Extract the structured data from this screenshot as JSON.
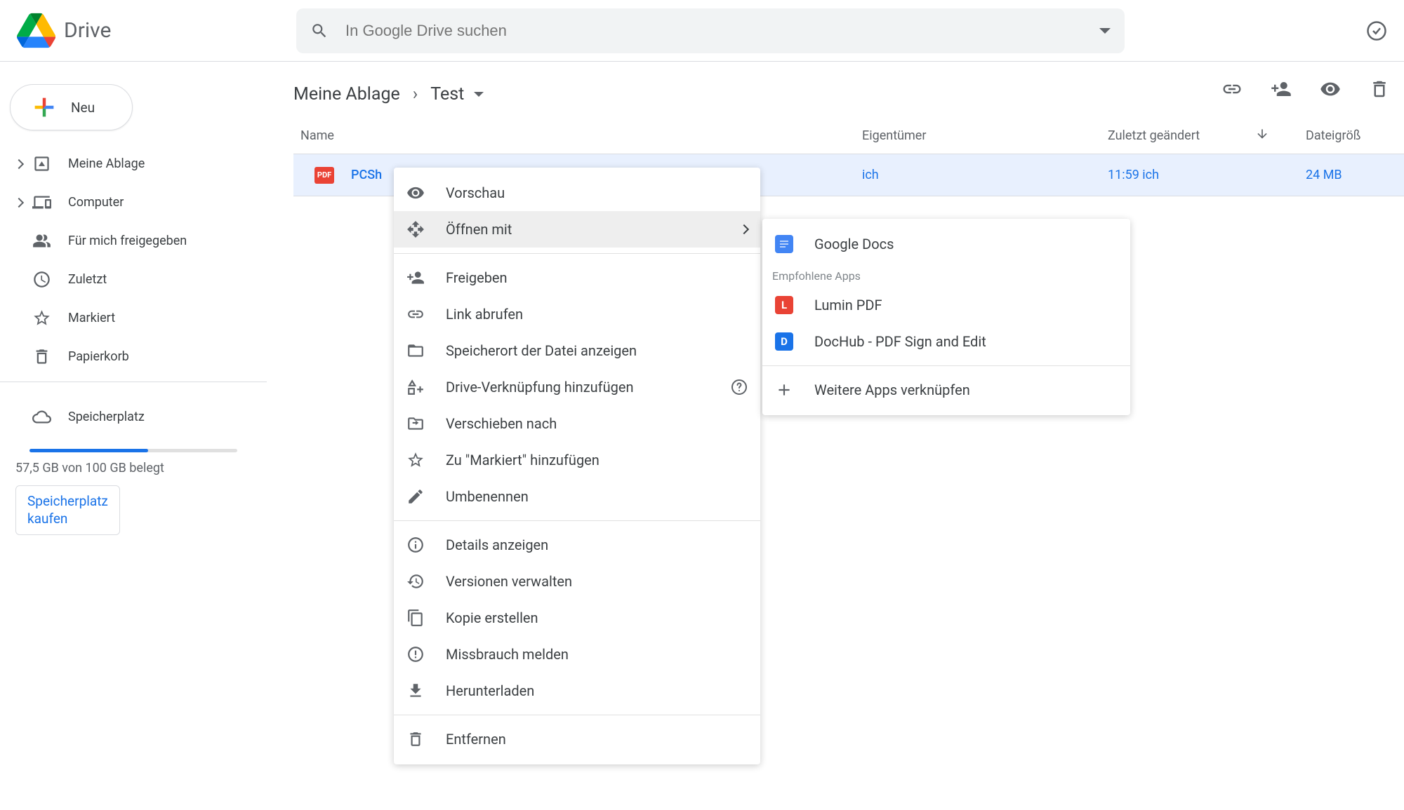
{
  "header": {
    "app_name": "Drive",
    "search_placeholder": "In Google Drive suchen"
  },
  "sidebar": {
    "new_button": "Neu",
    "items": [
      "Meine Ablage",
      "Computer",
      "Für mich freigegeben",
      "Zuletzt",
      "Markiert",
      "Papierkorb"
    ],
    "storage_label": "Speicherplatz",
    "storage_text": "57,5 GB von 100 GB belegt",
    "buy_storage_line1": "Speicherplatz",
    "buy_storage_line2": "kaufen"
  },
  "breadcrumb": {
    "root": "Meine Ablage",
    "current": "Test"
  },
  "columns": {
    "name": "Name",
    "owner": "Eigentümer",
    "modified": "Zuletzt geändert",
    "size": "Dateigröß"
  },
  "row": {
    "filename": "PCSh",
    "file_badge": "PDF",
    "owner": "ich",
    "modified": "11:59 ich",
    "size": "24 MB"
  },
  "context_menu": {
    "preview": "Vorschau",
    "open_with": "Öffnen mit",
    "share": "Freigeben",
    "get_link": "Link abrufen",
    "show_location": "Speicherort der Datei anzeigen",
    "add_shortcut": "Drive-Verknüpfung hinzufügen",
    "move_to": "Verschieben nach",
    "add_starred": "Zu \"Markiert\" hinzufügen",
    "rename": "Umbenennen",
    "details": "Details anzeigen",
    "versions": "Versionen verwalten",
    "make_copy": "Kopie erstellen",
    "report_abuse": "Missbrauch melden",
    "download": "Herunterladen",
    "remove": "Entfernen"
  },
  "submenu": {
    "google_docs": "Google Docs",
    "recommended_header": "Empfohlene Apps",
    "lumin": "Lumin PDF",
    "dochub": "DocHub - PDF Sign and Edit",
    "more_apps": "Weitere Apps verknüpfen"
  }
}
